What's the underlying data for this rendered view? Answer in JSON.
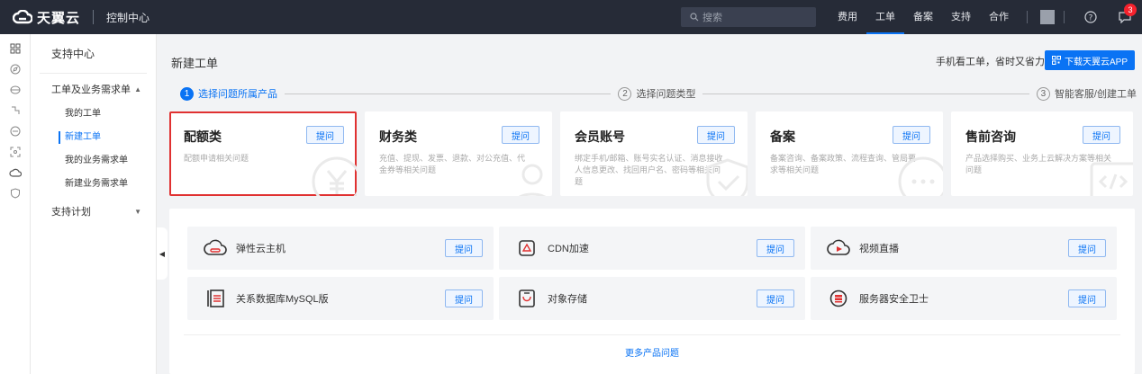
{
  "topbar": {
    "brand": "天翼云",
    "console": "控制中心",
    "search_placeholder": "搜索",
    "nav": [
      "费用",
      "工单",
      "备案",
      "支持",
      "合作"
    ],
    "active_nav": "工单",
    "notification_count": "3"
  },
  "sidebar": {
    "title": "支持中心",
    "groups": [
      {
        "label": "工单及业务需求单",
        "expanded": true,
        "items": [
          "我的工单",
          "新建工单",
          "我的业务需求单",
          "新建业务需求单"
        ]
      },
      {
        "label": "支持计划",
        "expanded": false,
        "items": []
      }
    ],
    "active_item": "新建工单"
  },
  "main": {
    "title": "新建工单",
    "app_tip": "手机看工单，省时又省力",
    "app_button": "下载天翼云APP",
    "steps": [
      {
        "num": "1",
        "label": "选择问题所属产品"
      },
      {
        "num": "2",
        "label": "选择问题类型"
      },
      {
        "num": "3",
        "label": "智能客服/创建工单"
      }
    ],
    "categories": [
      {
        "title": "配额类",
        "desc": "配额申请相关问题",
        "button": "提问"
      },
      {
        "title": "财务类",
        "desc": "充值、提现、发票、退款、对公充值、代金券等相关问题",
        "button": "提问"
      },
      {
        "title": "会员账号",
        "desc": "绑定手机/邮箱、账号实名认证、消息接收人信息更改、找回用户名、密码等相关问题",
        "button": "提问"
      },
      {
        "title": "备案",
        "desc": "备案咨询、备案政策、流程查询、管局要求等相关问题",
        "button": "提问"
      },
      {
        "title": "售前咨询",
        "desc": "产品选择购买、业务上云解决方案等相关问题",
        "button": "提问"
      }
    ],
    "products": [
      {
        "name": "弹性云主机",
        "icon": "cloud-host-icon",
        "button": "提问"
      },
      {
        "name": "CDN加速",
        "icon": "cdn-icon",
        "button": "提问"
      },
      {
        "name": "视频直播",
        "icon": "live-video-icon",
        "button": "提问"
      },
      {
        "name": "关系数据库MySQL版",
        "icon": "database-icon",
        "button": "提问"
      },
      {
        "name": "对象存储",
        "icon": "object-storage-icon",
        "button": "提问"
      },
      {
        "name": "服务器安全卫士",
        "icon": "server-security-icon",
        "button": "提问"
      }
    ],
    "more_link": "更多产品问题"
  },
  "colors": {
    "accent": "#0a73f4",
    "topbar": "#262b37",
    "selected_outline": "#e03131",
    "badge": "#f5222d"
  }
}
